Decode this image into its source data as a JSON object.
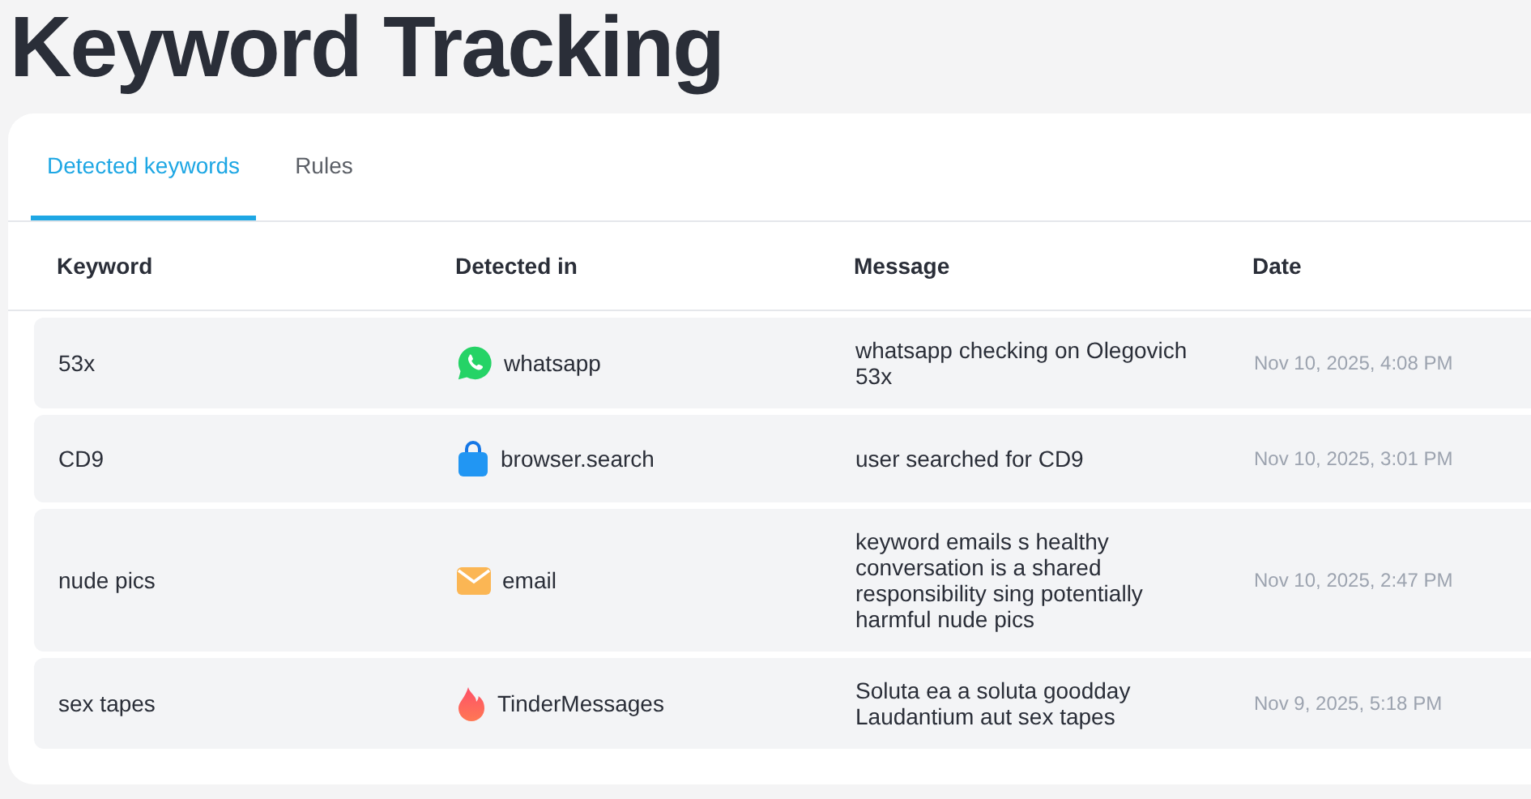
{
  "page_title": "Keyword Tracking",
  "tabs": [
    {
      "label": "Detected keywords",
      "selected": true
    },
    {
      "label": "Rules",
      "selected": false
    }
  ],
  "table": {
    "columns": [
      "Keyword",
      "Detected in",
      "Message",
      "Date"
    ],
    "rows": [
      {
        "keyword": "53x",
        "source": {
          "kind": "chat",
          "label": "whatsapp"
        },
        "message": "whatsapp checking on Olegovich 53x",
        "date": "Nov 10, 2025, 4:08 PM"
      },
      {
        "keyword": "CD9",
        "source": {
          "kind": "shopping",
          "label": "browser.search"
        },
        "message": "user searched for CD9",
        "date": "Nov 10, 2025, 3:01 PM"
      },
      {
        "keyword": "nude pics",
        "source": {
          "kind": "mail",
          "label": "email"
        },
        "message": "keyword emails s healthy conversation is a shared responsibility sing potentially harmful nude pics",
        "date": "Nov 10, 2025, 2:47 PM"
      },
      {
        "keyword": "sex tapes",
        "source": {
          "kind": "flame",
          "label": "TinderMessages"
        },
        "message": "Soluta ea a soluta goodday Laudantium aut sex tapes",
        "date": "Nov 9, 2025, 5:18 PM"
      }
    ]
  }
}
